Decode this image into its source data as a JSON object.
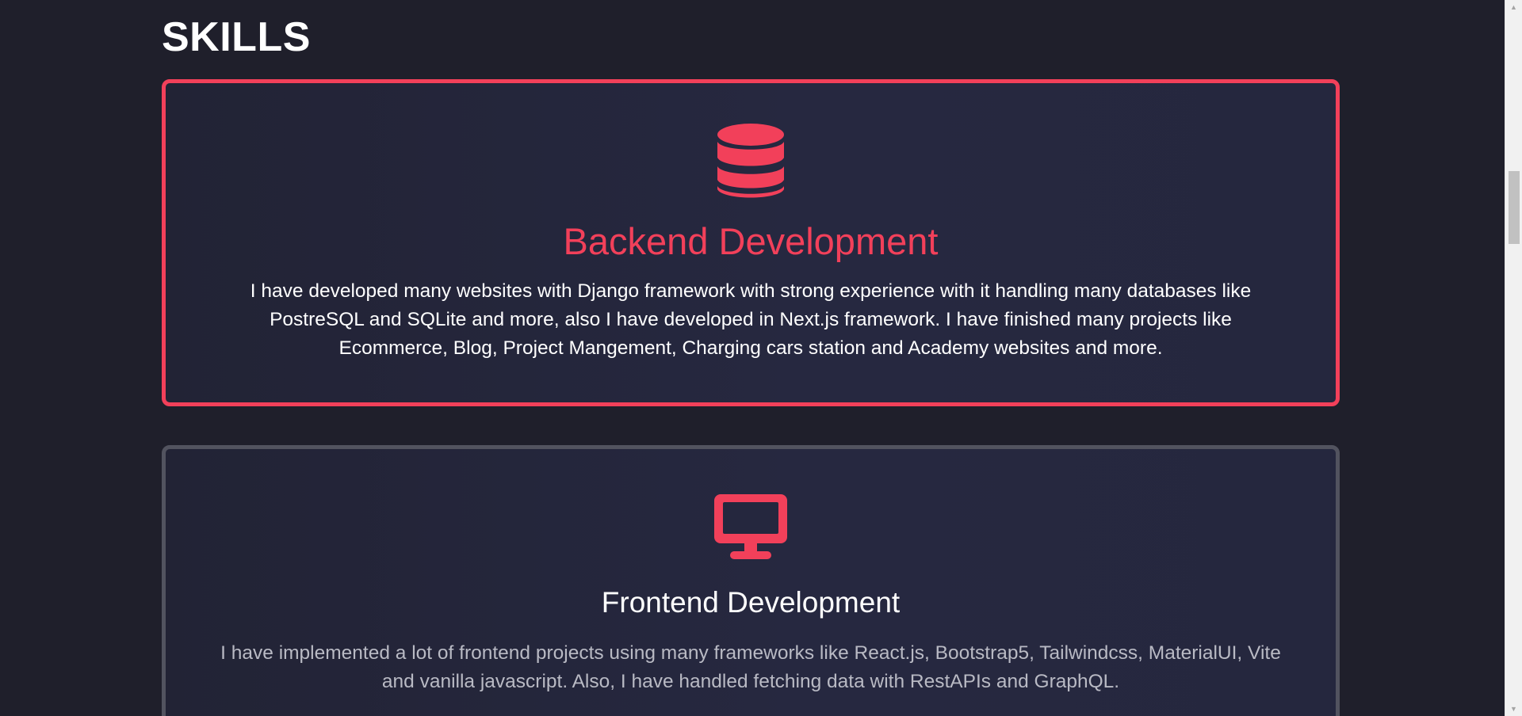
{
  "section": {
    "title": "SKILLS"
  },
  "cards": [
    {
      "icon": "database-icon",
      "title": "Backend Development",
      "text": "I have developed many websites with Django framework with strong experience with it handling many databases like PostreSQL and SQLite and more, also I have developed in Next.js framework. I have finished many projects like Ecommerce, Blog, Project Mangement, Charging cars station and Academy websites and more."
    },
    {
      "icon": "desktop-monitor-icon",
      "title": "Frontend Development",
      "text": "I have implemented a lot of frontend projects using many frameworks like React.js, Bootstrap5, Tailwindcss, MaterialUI, Vite and vanilla javascript. Also, I have handled fetching data with RestAPIs and GraphQL."
    }
  ],
  "colors": {
    "accent": "#f2405a",
    "background": "#1f1f2b",
    "card_background": "#25273e",
    "inactive_border": "#52535f",
    "text_primary": "#ffffff",
    "text_muted": "#b9bac4"
  },
  "scrollbar": {
    "up_arrow_icon": "triangle-up-icon",
    "down_arrow_icon": "triangle-down-icon"
  }
}
